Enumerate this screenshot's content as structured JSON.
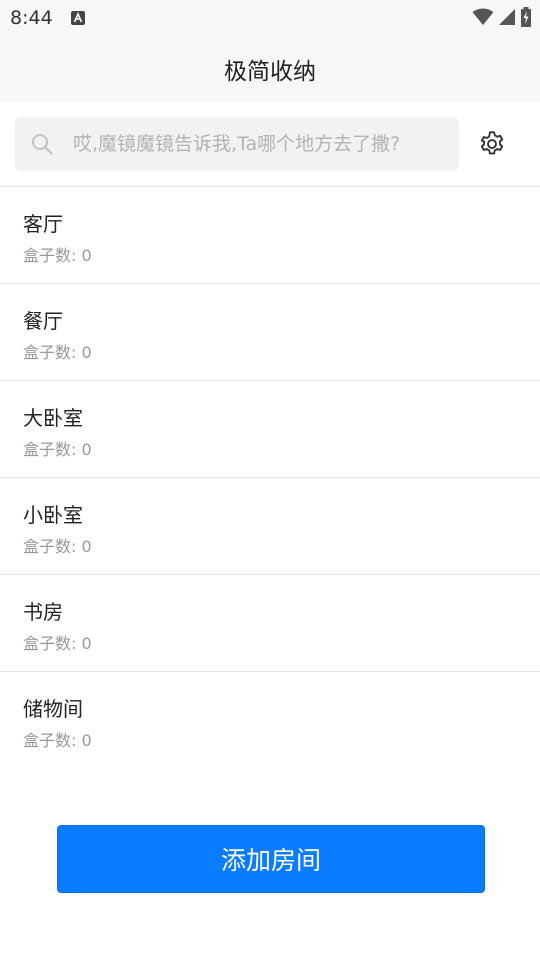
{
  "status_bar": {
    "time": "8:44",
    "icons": [
      "android-a-icon",
      "wifi-icon",
      "cellular-signal-icon",
      "battery-charging-icon"
    ]
  },
  "app_bar": {
    "title": "极简收纳"
  },
  "search": {
    "placeholder": "哎,魔镜魔镜告诉我,Ta哪个地方去了撒?",
    "value": "",
    "icon": "search-icon"
  },
  "settings": {
    "icon": "gear-icon"
  },
  "rooms": [
    {
      "name": "客厅",
      "count_label": "盒子数: 0"
    },
    {
      "name": "餐厅",
      "count_label": "盒子数: 0"
    },
    {
      "name": "大卧室",
      "count_label": "盒子数: 0"
    },
    {
      "name": "小卧室",
      "count_label": "盒子数: 0"
    },
    {
      "name": "书房",
      "count_label": "盒子数: 0"
    },
    {
      "name": "储物间",
      "count_label": "盒子数: 0"
    }
  ],
  "add_button": {
    "label": "添加房间"
  },
  "colors": {
    "primary": "#0a7cff",
    "bar_background": "#f7f7f7",
    "divider": "#e6e6e6",
    "secondary_text": "#999999"
  }
}
